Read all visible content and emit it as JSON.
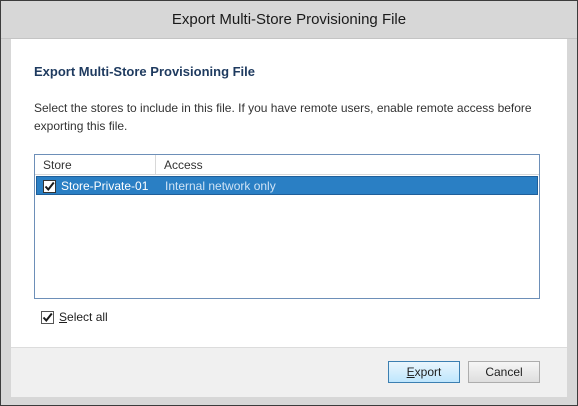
{
  "window": {
    "title": "Export Multi-Store Provisioning File"
  },
  "main": {
    "heading": "Export Multi-Store Provisioning File",
    "instructions": "Select the stores to include in this file. If you have remote users, enable remote access before exporting this file."
  },
  "grid": {
    "columns": {
      "store": "Store",
      "access": "Access"
    },
    "rows": [
      {
        "checked": true,
        "store": "Store-Private-01",
        "access": "Internal network only",
        "selected": true
      }
    ]
  },
  "select_all": {
    "checked": true,
    "label_accel": "S",
    "label_rest": "elect all"
  },
  "buttons": {
    "export_accel": "E",
    "export_rest": "xport",
    "cancel": "Cancel"
  },
  "colors": {
    "selection": "#2a7fc4",
    "heading": "#1e3a5f",
    "frame": "#d7d7d7"
  },
  "icons": {
    "check": "checkmark-icon"
  }
}
